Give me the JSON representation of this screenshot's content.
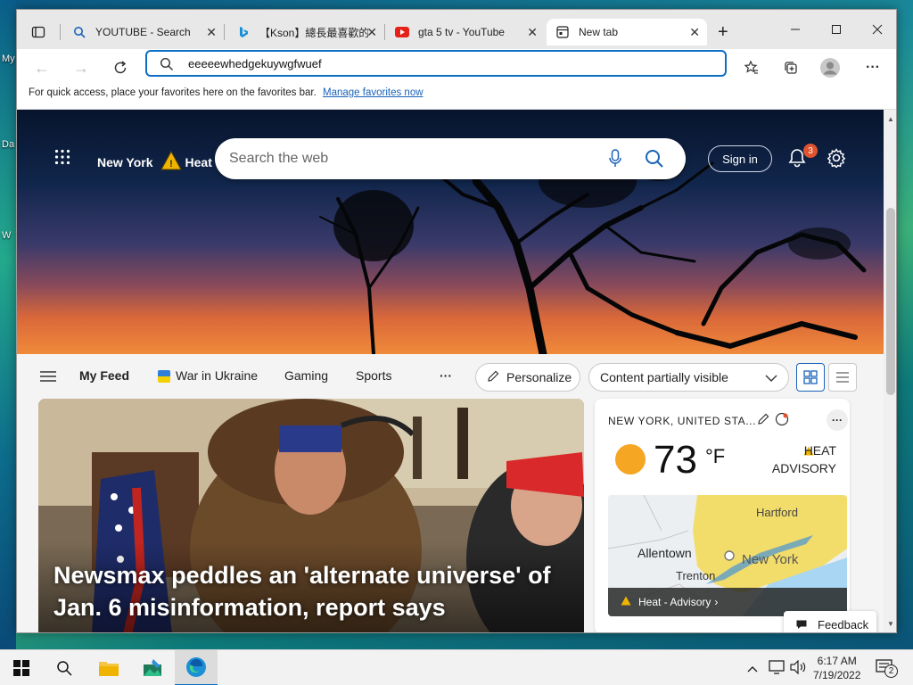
{
  "browser": {
    "tabs": [
      {
        "label": "YOUTUBE - Search",
        "icon": "search-icon"
      },
      {
        "label": "【Kson】總長最喜歡的",
        "icon": "bing-icon"
      },
      {
        "label": "gta 5 tv - YouTube",
        "icon": "youtube-icon"
      },
      {
        "label": "New tab",
        "icon": "newtab-icon",
        "active": true
      }
    ],
    "address_value": "eeeeewhedgekuywgfwuef",
    "favorites_text": "For quick access, place your favorites here on the favorites bar.",
    "favorites_link": "Manage favorites now"
  },
  "page": {
    "location": "New York",
    "alert_short": "Heat -",
    "search_placeholder": "Search the web",
    "sign_in": "Sign in",
    "notification_count": "3",
    "feed_tabs": [
      "My Feed",
      "War in Ukraine",
      "Gaming",
      "Sports"
    ],
    "more": "···",
    "personalize": "Personalize",
    "content_filter": "Content partially visible",
    "headline": "Newsmax peddles an 'alternate universe' of Jan. 6 misinformation, report says",
    "weather": {
      "place": "NEW YORK, UNITED STA...",
      "temp": "73",
      "unit": "°F",
      "alert_line1": "HEAT",
      "alert_line2": "ADVISORY",
      "map_labels": [
        "Hartford",
        "Allentown",
        "New York",
        "Trenton"
      ],
      "map_alert": "Heat - Advisory"
    },
    "feedback": "Feedback"
  },
  "desktop": {
    "icons_text": [
      "My",
      "Da",
      "W"
    ]
  },
  "taskbar": {
    "time": "6:17 AM",
    "date": "7/19/2022",
    "notifications": "2"
  },
  "colors": {
    "accent": "#0e6ec4",
    "sun": "#f5a623",
    "alert": "#f0b400"
  }
}
